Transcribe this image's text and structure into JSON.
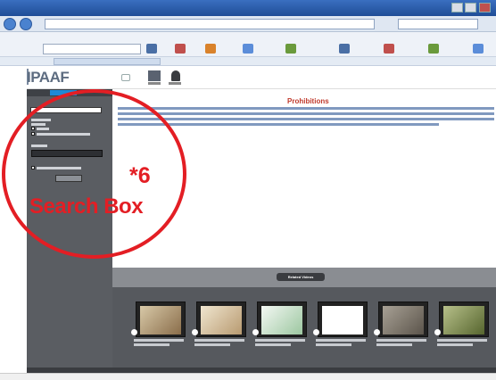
{
  "app": {
    "logo": "IPAAF"
  },
  "main": {
    "heading": "Prohibitions"
  },
  "videos": {
    "title": "Related Videos"
  },
  "callout": {
    "number": "*6",
    "label": "Search Box"
  },
  "colors": {
    "callout_red": "#e31e24",
    "heading_red": "#c0392b",
    "sidebar_gray": "#5a5d62",
    "accent_blue": "#1e8ad6"
  },
  "icons": [
    "back-icon",
    "forward-icon",
    "refresh-icon",
    "home-icon",
    "videos-icon",
    "profile-icon",
    "search-icon"
  ]
}
